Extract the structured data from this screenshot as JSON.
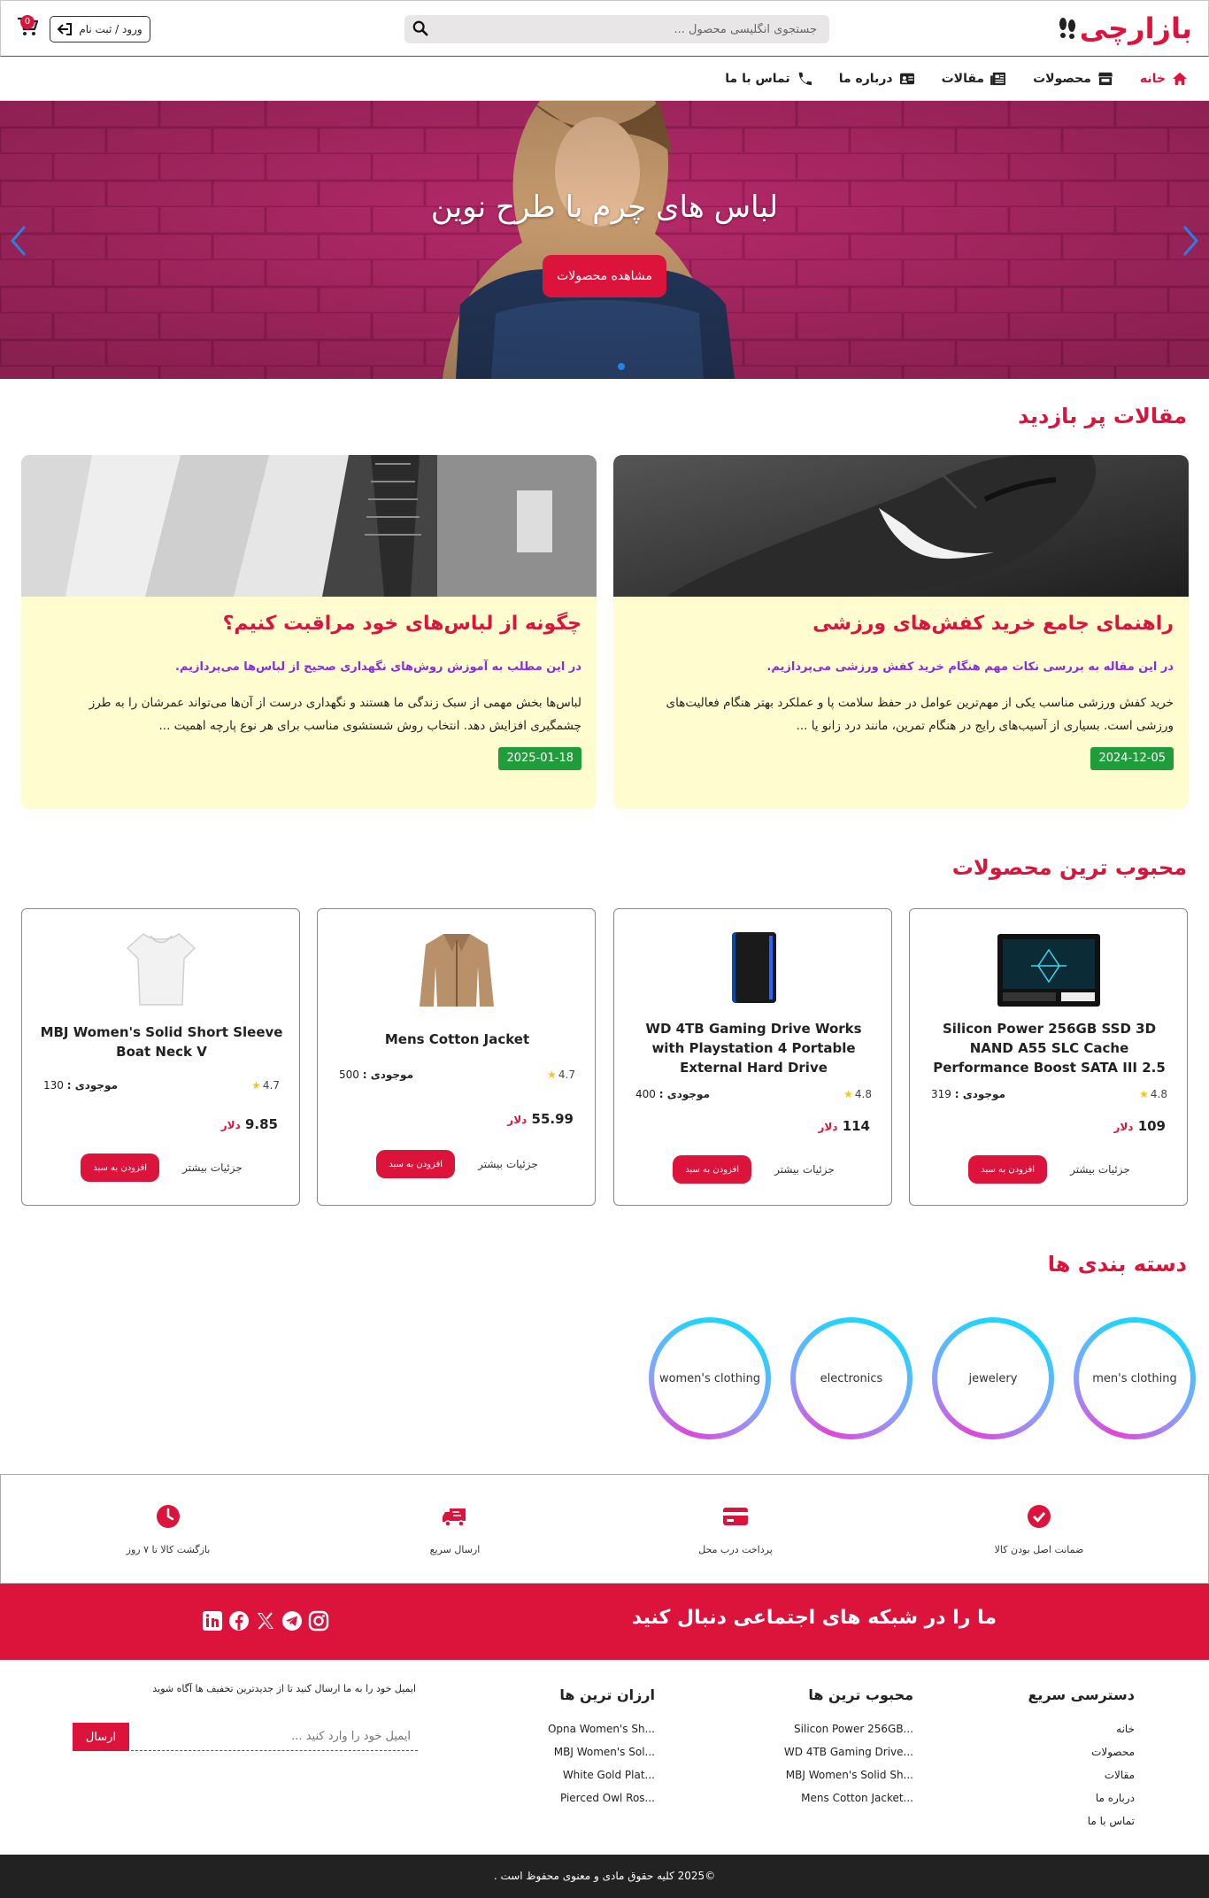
{
  "header": {
    "logo_text": "بازارچی",
    "search_placeholder": "جستجوی انگلیسی محصول ...",
    "login_label": "ورود / ثبت نام",
    "cart_count": "0"
  },
  "nav": {
    "items": [
      {
        "label": "خانه",
        "icon": "home-icon",
        "active": true
      },
      {
        "label": "محصولات",
        "icon": "store-icon"
      },
      {
        "label": "مقالات",
        "icon": "newspaper-icon"
      },
      {
        "label": "درباره ما",
        "icon": "id-card-icon"
      },
      {
        "label": "تماس با ما",
        "icon": "phone-icon"
      }
    ]
  },
  "hero": {
    "title": "لباس های چرم با طرح نوین",
    "cta_label": "مشاهده محصولات"
  },
  "articles": {
    "section_title": "مقالات پر بازدید",
    "items": [
      {
        "title": "راهنمای جامع خرید کفش‌های ورزشی",
        "subtitle": "در این مقاله به بررسی نکات مهم هنگام خرید کفش ورزشی می‌پردازیم.",
        "body": "خرید کفش ورزشی مناسب یکی از مهم‌ترین عوامل در حفظ سلامت پا و عملکرد بهتر هنگام فعالیت‌های ورزشی است. بسیاری از آسیب‌های رایج در هنگام تمرین، مانند درد زانو یا ...",
        "date": "2024-12-05"
      },
      {
        "title": "چگونه از لباس‌های خود مراقبت کنیم؟",
        "subtitle": "در این مطلب به آموزش روش‌های نگهداری صحیح از لباس‌ها می‌پردازیم.",
        "body": "لباس‌ها بخش مهمی از سبک زندگی ما هستند و نگهداری درست از آن‌ها می‌تواند عمرشان را به طرز چشمگیری افزایش دهد. انتخاب روش شستشوی مناسب برای هر نوع پارچه اهمیت ...",
        "date": "2025-01-18"
      }
    ]
  },
  "products": {
    "section_title": "محبوب ترین محصولات",
    "stock_label": "موجودی :",
    "currency": "دلار",
    "add_label": "افزودن به سبد",
    "details_label": "جزئیات بیشتر",
    "items": [
      {
        "name": "Silicon Power 256GB SSD 3D NAND A55 SLC Cache Performance Boost SATA III 2.5",
        "stock": "319",
        "rating": "4.8",
        "price": "109",
        "image": "ssd-image"
      },
      {
        "name": "WD 4TB Gaming Drive Works with Playstation 4 Portable External Hard Drive",
        "stock": "400",
        "rating": "4.8",
        "price": "114",
        "image": "hard-drive-image"
      },
      {
        "name": "Mens Cotton Jacket",
        "stock": "500",
        "rating": "4.7",
        "price": "55.99",
        "image": "jacket-image"
      },
      {
        "name": "MBJ Women's Solid Short Sleeve Boat Neck V",
        "stock": "130",
        "rating": "4.7",
        "price": "9.85",
        "image": "tshirt-image"
      }
    ]
  },
  "categories": {
    "section_title": "دسته بندی ها",
    "items": [
      "men's clothing",
      "jewelery",
      "electronics",
      "women's clothing"
    ]
  },
  "features": [
    {
      "label": "ضمانت اصل بودن کالا",
      "icon": "check-circle-icon"
    },
    {
      "label": "پرداخت درب محل",
      "icon": "credit-card-icon"
    },
    {
      "label": "ارسال سریع",
      "icon": "truck-icon"
    },
    {
      "label": "بازگشت کالا تا ۷ روز",
      "icon": "clock-icon"
    }
  ],
  "social": {
    "text": "ما را در شبکه های اجتماعی دنبال کنید",
    "icons": [
      "instagram-icon",
      "telegram-icon",
      "x-icon",
      "facebook-icon",
      "linkedin-icon"
    ]
  },
  "footer": {
    "quick_access": {
      "title": "دسترسی سریع",
      "links": [
        "خانه",
        "محصولات",
        "مقالات",
        "درباره ما",
        "تماس با ما"
      ]
    },
    "popular": {
      "title": "محبوب ترین ها",
      "links": [
        "Silicon Power 256GB...",
        "WD 4TB Gaming Drive...",
        "MBJ Women's Solid Sh...",
        "Mens Cotton Jacket..."
      ]
    },
    "cheapest": {
      "title": "ارزان ترین ها",
      "links": [
        "Opna Women's Sh...",
        "MBJ Women's Sol...",
        "White Gold Plat...",
        "Pierced Owl Ros..."
      ]
    },
    "newsletter_text": "ایمیل خود را به ما ارسال کنید تا از جدیدترین تخفیف ها آگاه شوید",
    "newsletter_placeholder": "ایمیل خود را وارد کنید ...",
    "newsletter_button": "ارسال",
    "copyright": "©2025 کلیه حقوق مادی و معنوی محفوظ است ."
  },
  "colors": {
    "accent": "#dc143c",
    "article_bg": "#fffdd0",
    "date_badge": "#1f9d3a",
    "subtitle": "#8a2be2",
    "footer_bottom": "#222222"
  }
}
